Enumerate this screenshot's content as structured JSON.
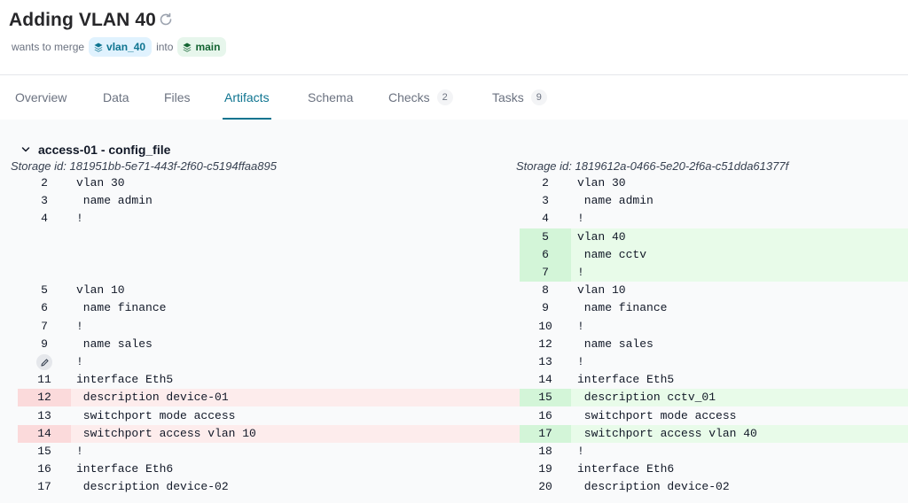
{
  "header": {
    "title": "Adding VLAN 40",
    "merge_text": "wants to merge",
    "source_branch": "vlan_40",
    "into_text": "into",
    "target_branch": "main"
  },
  "tabs": [
    {
      "label": "Overview",
      "count": ""
    },
    {
      "label": "Data",
      "count": ""
    },
    {
      "label": "Files",
      "count": ""
    },
    {
      "label": "Artifacts",
      "count": "",
      "active": true
    },
    {
      "label": "Schema",
      "count": ""
    },
    {
      "label": "Checks",
      "count": "2"
    },
    {
      "label": "Tasks",
      "count": "9"
    }
  ],
  "artifact": {
    "title": "access-01 - config_file",
    "left_storage": "Storage id: 181951bb-5e71-443f-2f60-c5194ffaa895",
    "right_storage": "Storage id: 1819612a-0466-5e20-2f6a-c51dda61377f"
  },
  "diff": [
    {
      "ln": "2",
      "lc": "vlan 30",
      "rn": "2",
      "rc": "vlan 30",
      "type": "same"
    },
    {
      "ln": "3",
      "lc": " name admin",
      "rn": "3",
      "rc": " name admin",
      "type": "same"
    },
    {
      "ln": "4",
      "lc": "!",
      "rn": "4",
      "rc": "!",
      "type": "same"
    },
    {
      "ln": "",
      "lc": "",
      "rn": "5",
      "rc": "vlan 40",
      "type": "add"
    },
    {
      "ln": "",
      "lc": "",
      "rn": "6",
      "rc": " name cctv",
      "type": "add"
    },
    {
      "ln": "",
      "lc": "",
      "rn": "7",
      "rc": "!",
      "type": "add"
    },
    {
      "ln": "5",
      "lc": "vlan 10",
      "rn": "8",
      "rc": "vlan 10",
      "type": "same"
    },
    {
      "ln": "6",
      "lc": " name finance",
      "rn": "9",
      "rc": " name finance",
      "type": "same"
    },
    {
      "ln": "7",
      "lc": "!",
      "rn": "10",
      "rc": "!",
      "type": "same"
    },
    {
      "ln": "9",
      "lc": " name sales",
      "rn": "12",
      "rc": " name sales",
      "type": "same"
    },
    {
      "ln": "",
      "lc": "!",
      "rn": "13",
      "rc": "!",
      "type": "same",
      "pencil": true
    },
    {
      "ln": "11",
      "lc": "interface Eth5",
      "rn": "14",
      "rc": "interface Eth5",
      "type": "same"
    },
    {
      "ln": "12",
      "lc": " description device-01",
      "rn": "15",
      "rc": " description cctv_01",
      "type": "change"
    },
    {
      "ln": "13",
      "lc": " switchport mode access",
      "rn": "16",
      "rc": " switchport mode access",
      "type": "same"
    },
    {
      "ln": "14",
      "lc": " switchport access vlan 10",
      "rn": "17",
      "rc": " switchport access vlan 40",
      "type": "change"
    },
    {
      "ln": "15",
      "lc": "!",
      "rn": "18",
      "rc": "!",
      "type": "same"
    },
    {
      "ln": "16",
      "lc": "interface Eth6",
      "rn": "19",
      "rc": "interface Eth6",
      "type": "same"
    },
    {
      "ln": "17",
      "lc": " description device-02",
      "rn": "20",
      "rc": " description device-02",
      "type": "same"
    }
  ]
}
